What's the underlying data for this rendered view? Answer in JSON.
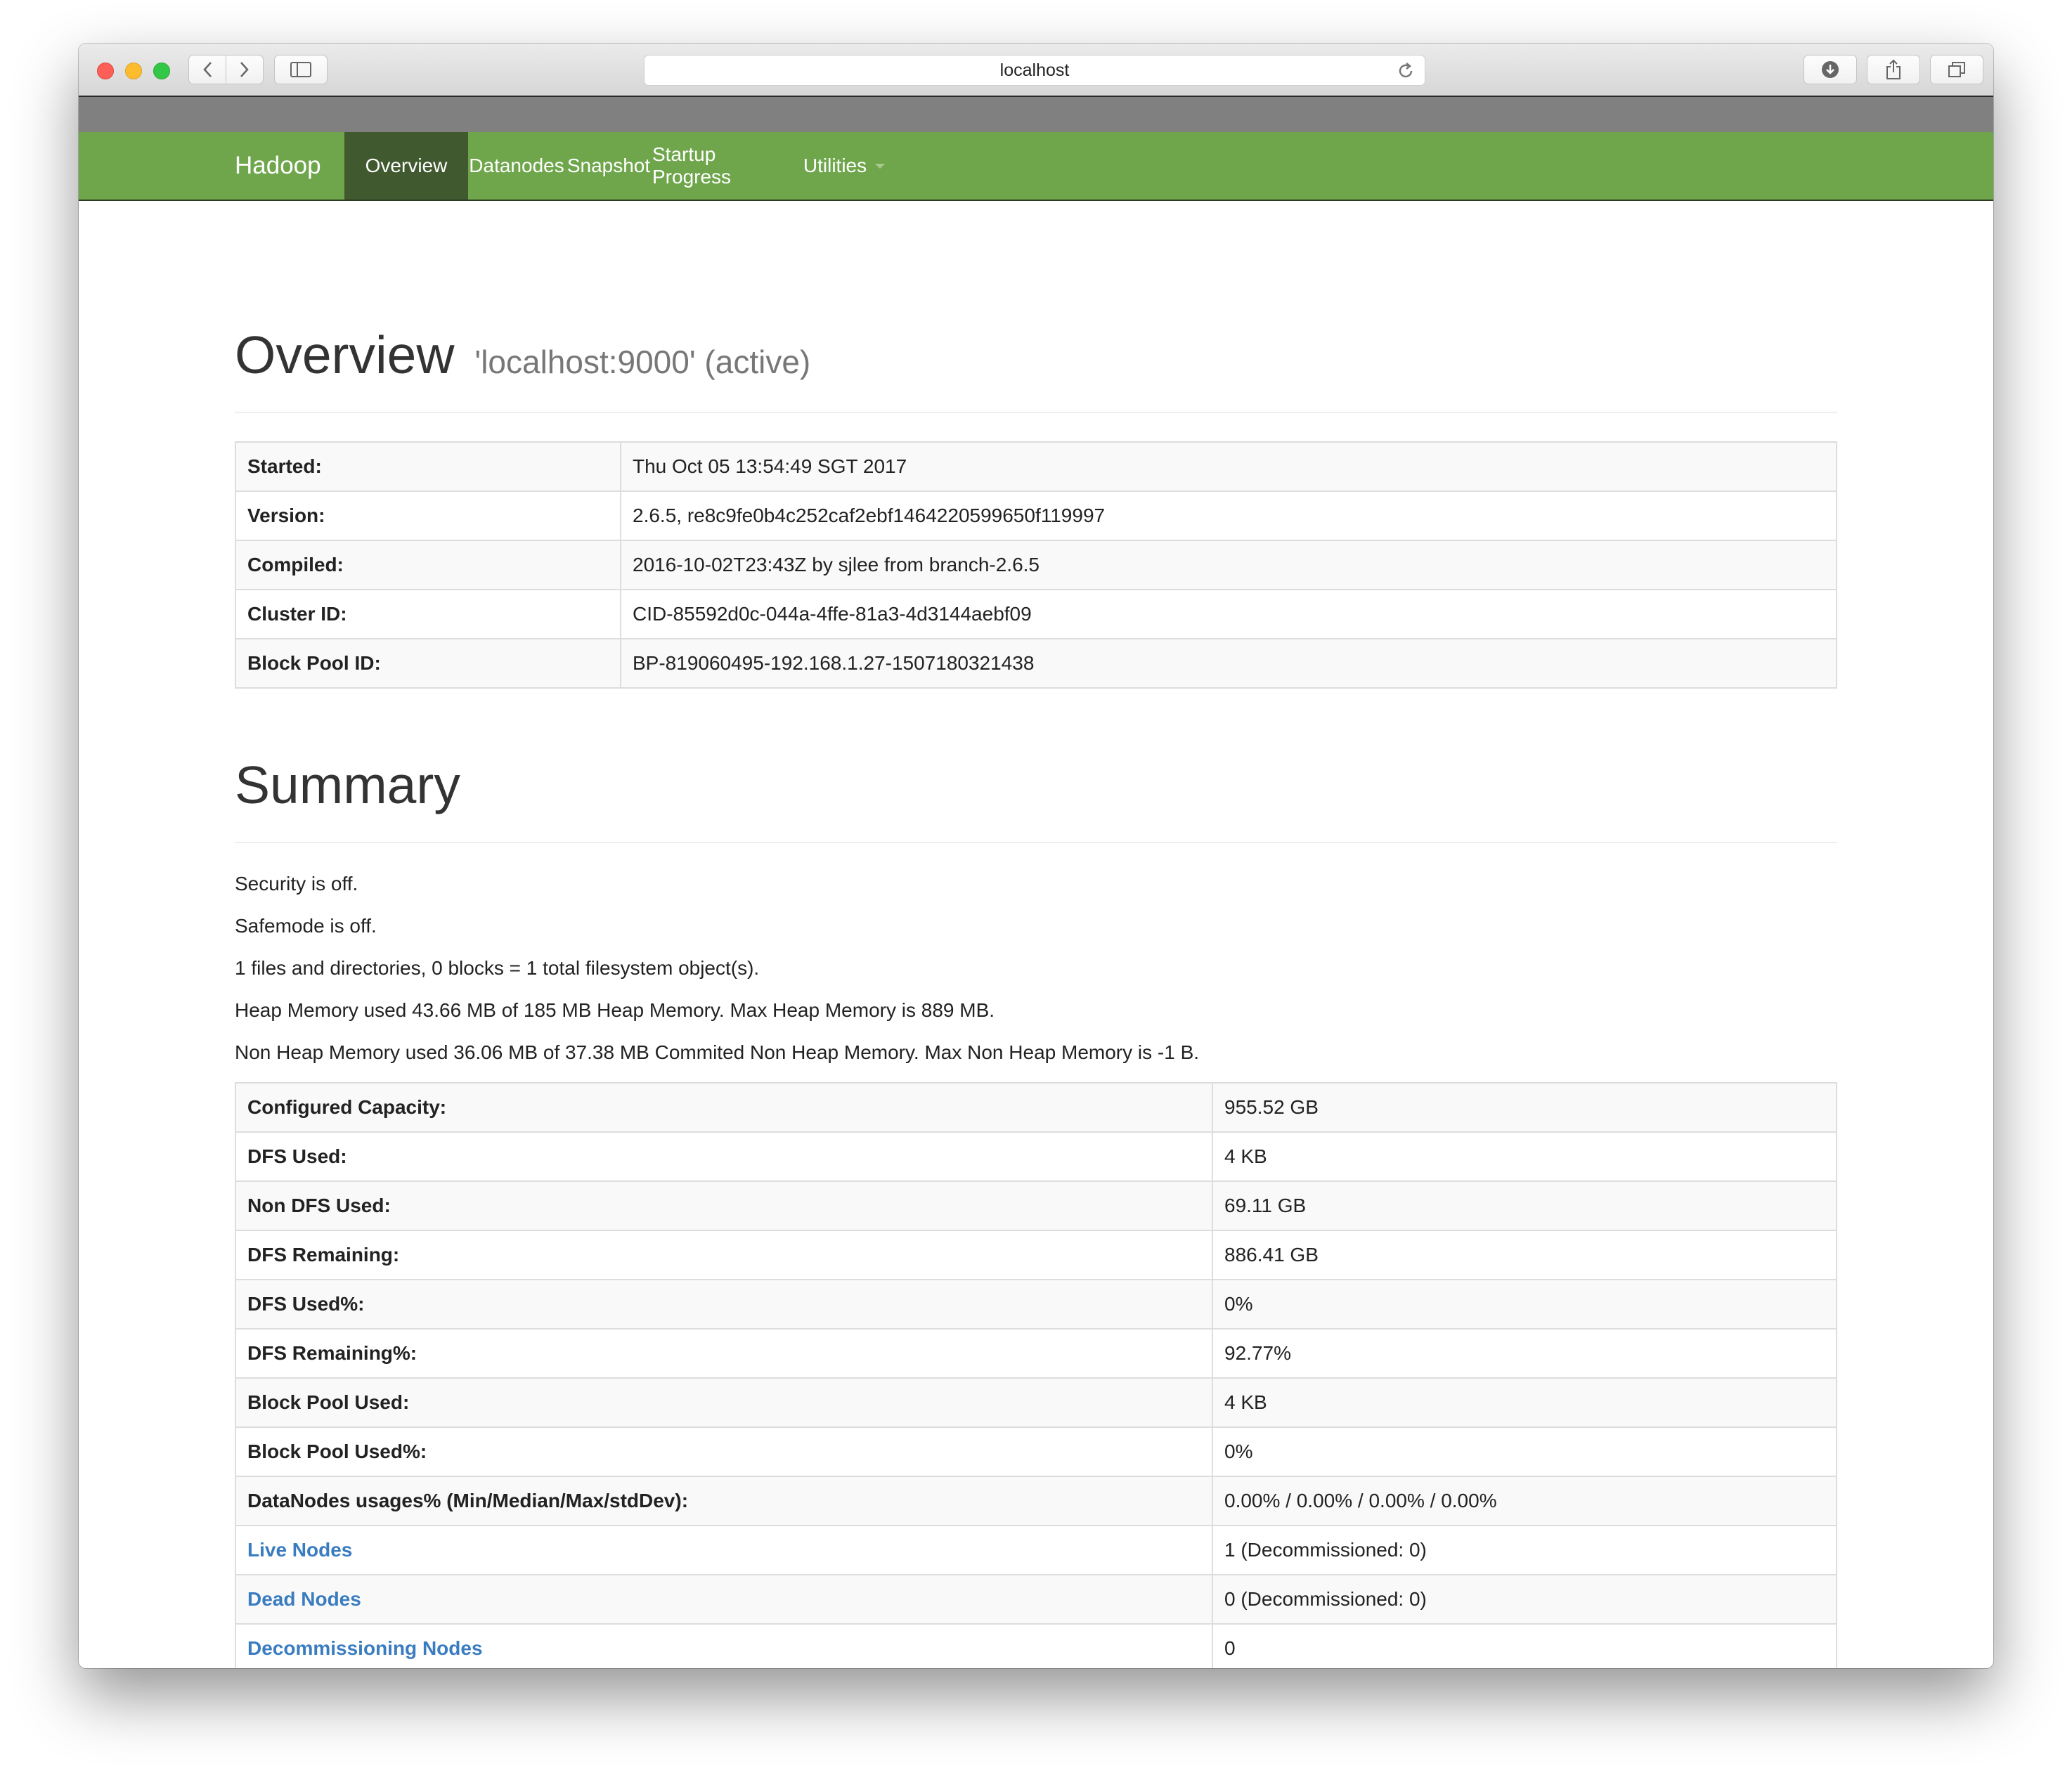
{
  "browser": {
    "url": "localhost"
  },
  "navbar": {
    "brand": "Hadoop",
    "items": [
      "Overview",
      "Datanodes",
      "Snapshot",
      "Startup Progress",
      "Utilities"
    ]
  },
  "overview": {
    "title": "Overview",
    "subtitle": "'localhost:9000' (active)",
    "rows": [
      {
        "label": "Started:",
        "value": "Thu Oct 05 13:54:49 SGT 2017"
      },
      {
        "label": "Version:",
        "value": "2.6.5, re8c9fe0b4c252caf2ebf1464220599650f119997"
      },
      {
        "label": "Compiled:",
        "value": "2016-10-02T23:43Z by sjlee from branch-2.6.5"
      },
      {
        "label": "Cluster ID:",
        "value": "CID-85592d0c-044a-4ffe-81a3-4d3144aebf09"
      },
      {
        "label": "Block Pool ID:",
        "value": "BP-819060495-192.168.1.27-1507180321438"
      }
    ]
  },
  "summary": {
    "title": "Summary",
    "lines": [
      "Security is off.",
      "Safemode is off.",
      "1 files and directories, 0 blocks = 1 total filesystem object(s).",
      "Heap Memory used 43.66 MB of 185 MB Heap Memory. Max Heap Memory is 889 MB.",
      "Non Heap Memory used 36.06 MB of 37.38 MB Commited Non Heap Memory. Max Non Heap Memory is -1 B."
    ],
    "rows": [
      {
        "label": "Configured Capacity:",
        "value": "955.52 GB"
      },
      {
        "label": "DFS Used:",
        "value": "4 KB"
      },
      {
        "label": "Non DFS Used:",
        "value": "69.11 GB"
      },
      {
        "label": "DFS Remaining:",
        "value": "886.41 GB"
      },
      {
        "label": "DFS Used%:",
        "value": "0%"
      },
      {
        "label": "DFS Remaining%:",
        "value": "92.77%"
      },
      {
        "label": "Block Pool Used:",
        "value": "4 KB"
      },
      {
        "label": "Block Pool Used%:",
        "value": "0%"
      },
      {
        "label": "DataNodes usages% (Min/Median/Max/stdDev):",
        "value": "0.00% / 0.00% / 0.00% / 0.00%"
      },
      {
        "label": "Live Nodes",
        "value": "1 (Decommissioned: 0)"
      },
      {
        "label": "Dead Nodes",
        "value": "0 (Decommissioned: 0)"
      },
      {
        "label": "Decommissioning Nodes",
        "value": "0"
      }
    ]
  }
}
